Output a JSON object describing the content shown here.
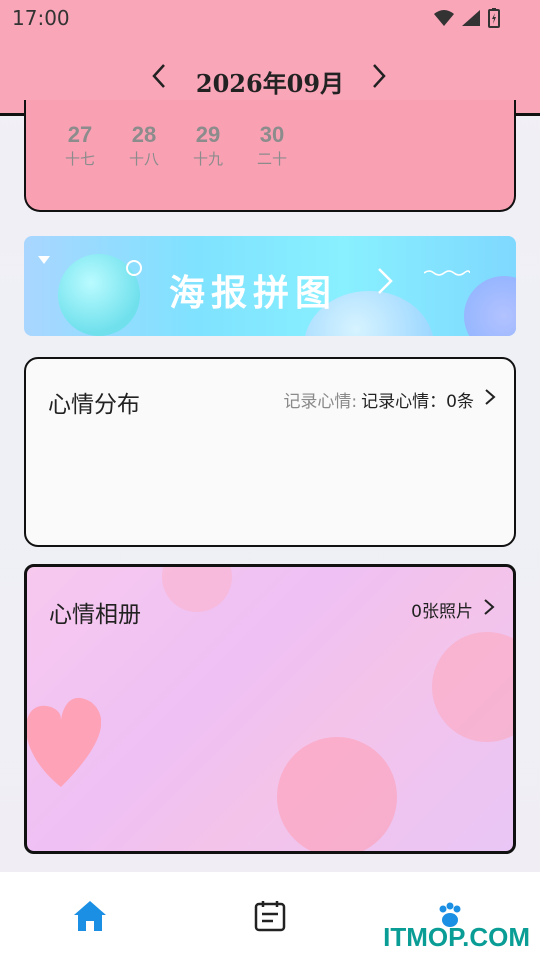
{
  "status": {
    "time": "17:00"
  },
  "header": {
    "month_title": "2026年09月",
    "prev_label": "‹",
    "next_label": "›"
  },
  "calendar": {
    "days": [
      {
        "num": "27",
        "lunar": "十七"
      },
      {
        "num": "28",
        "lunar": "十八"
      },
      {
        "num": "29",
        "lunar": "十九"
      },
      {
        "num": "30",
        "lunar": "二十"
      }
    ]
  },
  "banner": {
    "label": "海报拼图"
  },
  "mood_distribution": {
    "title": "心情分布",
    "record_label": "记录心情:",
    "record_value": "记录心情：0条"
  },
  "mood_album": {
    "title": "心情相册",
    "count_label": "0张照片"
  },
  "bottom_nav": {
    "items": [
      "home-icon",
      "calendar-note-icon",
      "paw-icon"
    ],
    "active_color": "#1a8fe3"
  },
  "watermark": {
    "text": "ITMOP.COM"
  },
  "colors": {
    "header_pink": "#f9a6b9",
    "calendar_pink": "#f9a0b3"
  }
}
